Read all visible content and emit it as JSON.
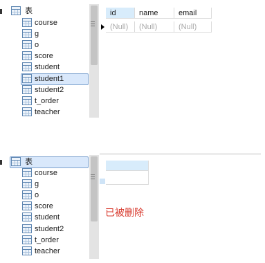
{
  "panel1": {
    "tree": {
      "root_label": "表",
      "items": [
        "course",
        "g",
        "o",
        "score",
        "student",
        "student1",
        "student2",
        "t_order",
        "teacher"
      ],
      "selected_item": "student1"
    },
    "grid": {
      "columns": [
        "id",
        "name",
        "email"
      ],
      "rows": [
        [
          "(Null)",
          "(Null)",
          "(Null)"
        ]
      ]
    }
  },
  "panel2": {
    "tree": {
      "root_label": "表",
      "items": [
        "course",
        "g",
        "o",
        "score",
        "student",
        "student2",
        "t_order",
        "teacher"
      ],
      "selected_item": "表"
    },
    "status_message": "已被删除"
  },
  "colors": {
    "selection": "#d9e8fb",
    "header_selected": "#d8ecfb",
    "deleted_text": "#d83a2e",
    "null_text": "#a8a8a8"
  }
}
